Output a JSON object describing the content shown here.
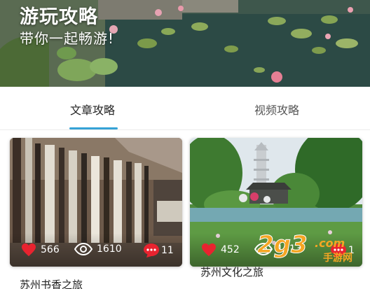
{
  "banner": {
    "title": "游玩攻略",
    "subtitle": "带你一起畅游!"
  },
  "tabs": [
    {
      "label": "文章攻略",
      "active": true
    },
    {
      "label": "视频攻略",
      "active": false
    }
  ],
  "accent_color": "#35a2d6",
  "cards": [
    {
      "title": "苏州书香之旅",
      "likes": "566",
      "views": "1610",
      "comments": "11",
      "image": "bookshelf-library-photo"
    },
    {
      "title": "苏州文化之旅",
      "likes": "452",
      "views": "1613",
      "comments": "1",
      "image": "pagoda-lake-photo"
    }
  ],
  "watermark": {
    "brand": "2g3.com",
    "subtext": "手游网"
  },
  "icons": {
    "likes": "heart-icon",
    "views": "eye-icon",
    "comments": "comment-bubble-icon"
  }
}
